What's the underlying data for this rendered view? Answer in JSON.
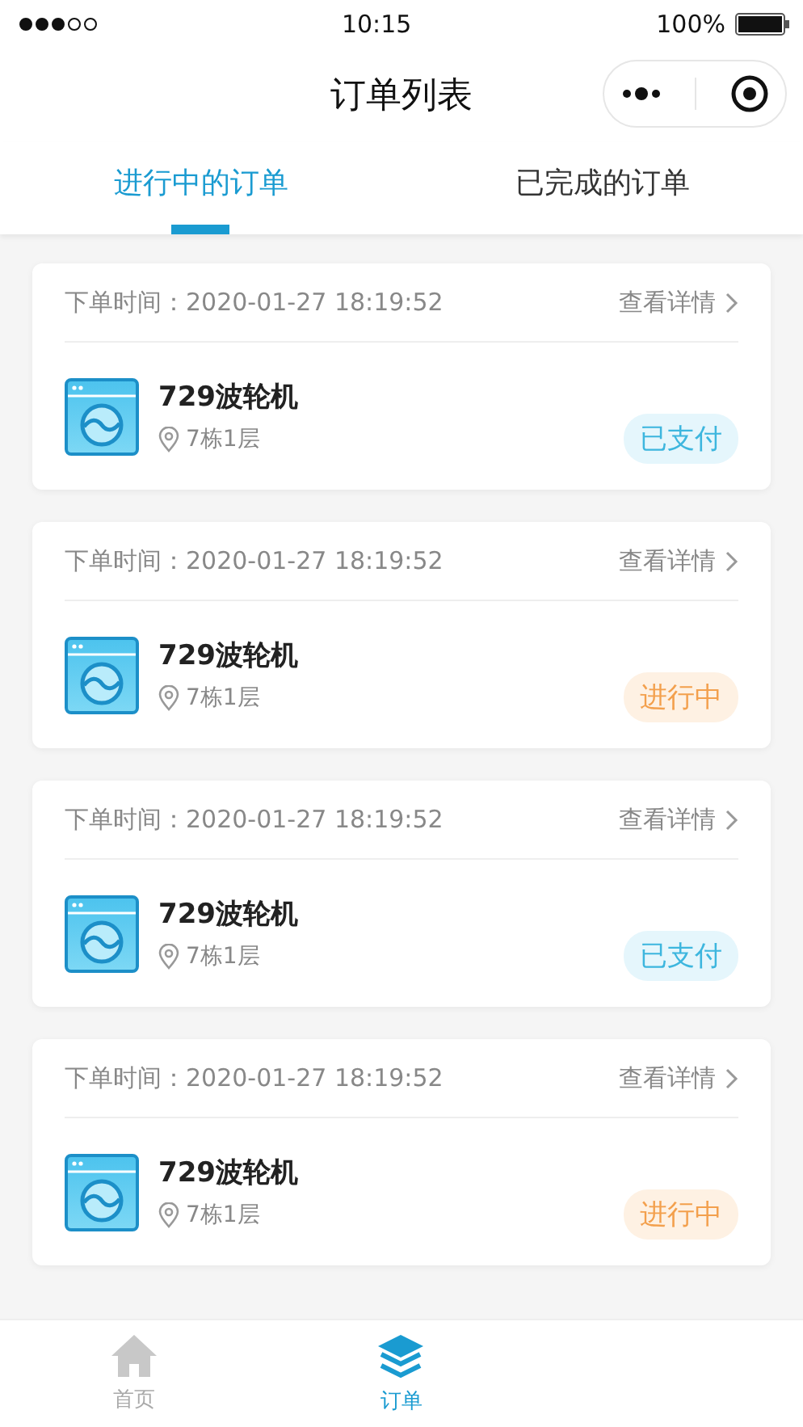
{
  "status_bar": {
    "time": "10:15",
    "battery": "100%"
  },
  "header": {
    "title": "订单列表"
  },
  "tabs": [
    {
      "label": "进行中的订单",
      "selected": true
    },
    {
      "label": "已完成的订单",
      "selected": false
    }
  ],
  "orders": [
    {
      "time_label": "下单时间：",
      "time": "2020-01-27  18:19:52",
      "detail_link": "查看详情",
      "name": "729波轮机",
      "location": "7栋1层",
      "status": {
        "kind": "paid",
        "label": "已支付"
      }
    },
    {
      "time_label": "下单时间：",
      "time": "2020-01-27  18:19:52",
      "detail_link": "查看详情",
      "name": "729波轮机",
      "location": "7栋1层",
      "status": {
        "kind": "in_progress",
        "label": "进行中"
      }
    },
    {
      "time_label": "下单时间：",
      "time": "2020-01-27  18:19:52",
      "detail_link": "查看详情",
      "name": "729波轮机",
      "location": "7栋1层",
      "status": {
        "kind": "paid",
        "label": "已支付"
      }
    },
    {
      "time_label": "下单时间：",
      "time": "2020-01-27  18:19:52",
      "detail_link": "查看详情",
      "name": "729波轮机",
      "location": "7栋1层",
      "status": {
        "kind": "in_progress",
        "label": "进行中"
      }
    }
  ],
  "tab_bar": [
    {
      "kind": "home",
      "label": "首页",
      "selected": false
    },
    {
      "kind": "orders",
      "label": "订单",
      "selected": true
    }
  ]
}
